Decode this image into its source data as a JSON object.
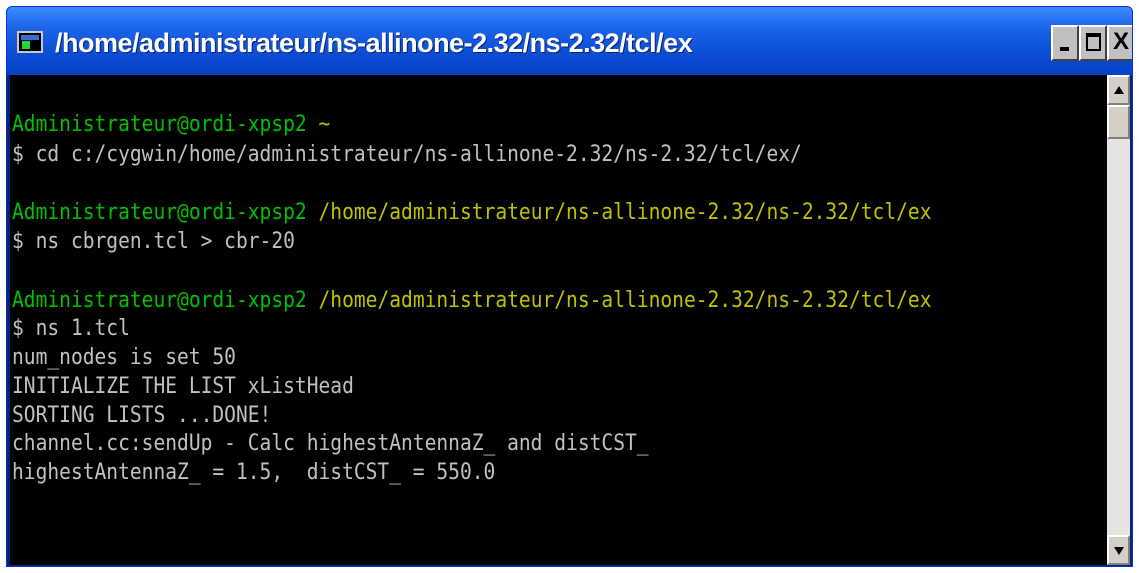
{
  "window": {
    "title": "/home/administrateur/ns-allinone-2.32/ns-2.32/tcl/ex",
    "icon": "cygwin-terminal-icon",
    "buttons": {
      "minimize_icon": "minimize-icon",
      "maximize_icon": "maximize-icon",
      "close_label": "X"
    }
  },
  "colors": {
    "prompt_user": "#00c000",
    "prompt_path": "#c0c000",
    "text": "#c0c0c0",
    "background": "#000000",
    "titlebar": "#0a4cd4"
  },
  "terminal": {
    "blocks": [
      {
        "prompt_user": "Administrateur@ordi-xpsp2",
        "prompt_path": "~",
        "command": "$ cd c:/cygwin/home/administrateur/ns-allinone-2.32/ns-2.32/tcl/ex/",
        "output": []
      },
      {
        "prompt_user": "Administrateur@ordi-xpsp2",
        "prompt_path": "/home/administrateur/ns-allinone-2.32/ns-2.32/tcl/ex",
        "command": "$ ns cbrgen.tcl > cbr-20",
        "output": []
      },
      {
        "prompt_user": "Administrateur@ordi-xpsp2",
        "prompt_path": "/home/administrateur/ns-allinone-2.32/ns-2.32/tcl/ex",
        "command": "$ ns 1.tcl",
        "output": [
          "num_nodes is set 50",
          "INITIALIZE THE LIST xListHead",
          "SORTING LISTS ...DONE!",
          "channel.cc:sendUp - Calc highestAntennaZ_ and distCST_",
          "highestAntennaZ_ = 1.5,  distCST_ = 550.0"
        ]
      }
    ]
  },
  "scrollbar": {
    "up_icon": "scroll-up-arrow-icon",
    "down_icon": "scroll-down-arrow-icon"
  }
}
